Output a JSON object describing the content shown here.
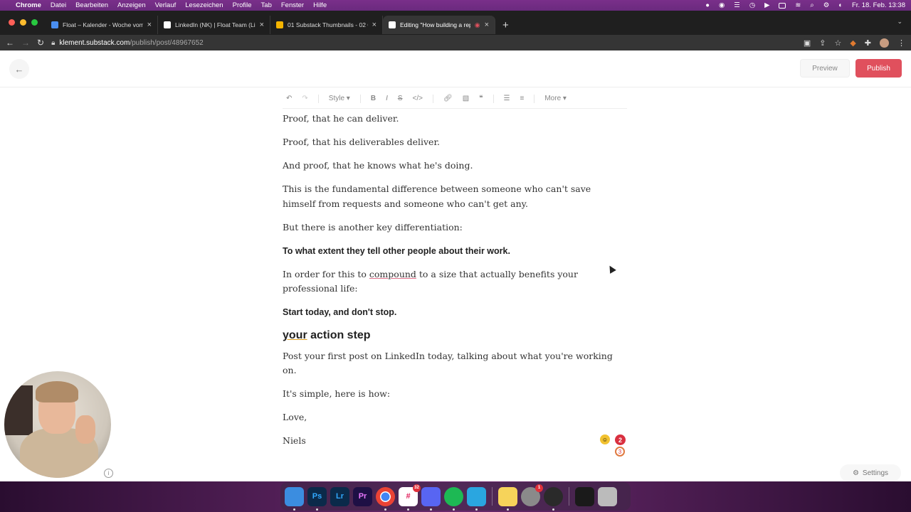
{
  "menubar": {
    "app": "Chrome",
    "items": [
      "Datei",
      "Bearbeiten",
      "Anzeigen",
      "Verlauf",
      "Lesezeichen",
      "Profile",
      "Tab",
      "Fenster",
      "Hilfe"
    ],
    "clock": "Fr. 18. Feb. 13:38"
  },
  "browser": {
    "tabs": [
      {
        "title": "Float – Kalender - Woche vom",
        "color": "#4a8ef0"
      },
      {
        "title": "LinkedIn (NK) | Float Team (Li",
        "color": "#ffffff"
      },
      {
        "title": "01 Substack Thumbnails - 02 C",
        "color": "#f4b400"
      },
      {
        "title": "Editing \"How building a rep",
        "color": "#ffffff"
      }
    ],
    "url_host": "klement.substack.com",
    "url_path": "/publish/post/48967652"
  },
  "editor": {
    "preview_label": "Preview",
    "publish_label": "Publish",
    "toolbar": {
      "style": "Style",
      "more": "More"
    },
    "paragraphs": {
      "p1": "Proof, that he can deliver.",
      "p2": "Proof, that his deliverables deliver.",
      "p3": "And proof, that he knows what he's doing.",
      "p4": "This is the fundamental difference between someone who can't save himself from requests and someone who can't get any.",
      "p5": "But there is another key differentiation:",
      "p6": "To what extent they tell other people about their work.",
      "p7a": "In order for this to ",
      "p7b": "compound",
      "p7c": " to a size that actually benefits your professional life:",
      "p8": "Start today, and don't stop.",
      "h2a": "your",
      "h2b": " action step",
      "p9": "Post your first post on LinkedIn today, talking about what you're working on.",
      "p10": "It's simple, here is how:",
      "p11": "Love,",
      "p12": "Niels"
    },
    "badges": {
      "count_red": "2",
      "count_ring": "3"
    },
    "settings_label": "Settings"
  },
  "dock": {
    "apps": [
      {
        "name": "finder",
        "label": "",
        "color": "#3b8de0"
      },
      {
        "name": "photoshop",
        "label": "Ps",
        "color": "#0b2a4a"
      },
      {
        "name": "lightroom",
        "label": "Lr",
        "color": "#0b2a4a"
      },
      {
        "name": "premiere",
        "label": "Pr",
        "color": "#1e1045"
      },
      {
        "name": "chrome",
        "label": "",
        "color": "#e8e8e8"
      },
      {
        "name": "slack",
        "label": "",
        "color": "#4a154b",
        "badge": "32"
      },
      {
        "name": "discord",
        "label": "",
        "color": "#5865f2"
      },
      {
        "name": "spotify",
        "label": "",
        "color": "#1db954"
      },
      {
        "name": "icloud",
        "label": "",
        "color": "#2aa6e0"
      },
      {
        "name": "notes",
        "label": "",
        "color": "#f6d35a"
      },
      {
        "name": "system-prefs",
        "label": "",
        "color": "#8a8a8a",
        "badge": "1"
      },
      {
        "name": "quicktime",
        "label": "",
        "color": "#2a2a2a"
      },
      {
        "name": "screen-record",
        "label": "",
        "color": "#1a1a1a"
      },
      {
        "name": "trash",
        "label": "",
        "color": "#bbbbbb"
      }
    ]
  }
}
